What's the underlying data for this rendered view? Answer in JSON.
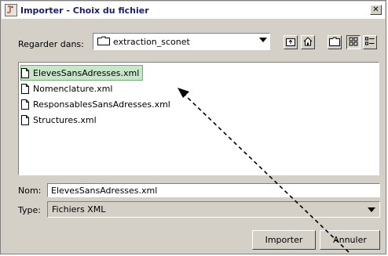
{
  "window": {
    "title": "Importer - Choix du fichier",
    "close_label": "✕"
  },
  "lookin": {
    "label": "Regarder dans:",
    "value": "extraction_sconet"
  },
  "toolbar": {
    "buttons": [
      {
        "name": "up-folder-icon"
      },
      {
        "name": "home-icon"
      },
      {
        "name": "new-folder-icon"
      },
      {
        "name": "list-view-icon"
      },
      {
        "name": "details-view-icon"
      }
    ]
  },
  "files": [
    {
      "name": "ElevesSansAdresses.xml",
      "selected": true
    },
    {
      "name": "Nomenclature.xml",
      "selected": false
    },
    {
      "name": "ResponsablesSansAdresses.xml",
      "selected": false
    },
    {
      "name": "Structures.xml",
      "selected": false
    }
  ],
  "filename": {
    "label": "Nom:",
    "value": "ElevesSansAdresses.xml"
  },
  "filetype": {
    "label": "Type:",
    "value": "Fichiers XML"
  },
  "actions": {
    "import_label": "Importer",
    "cancel_label": "Annuler"
  },
  "colors": {
    "selection": "#c8e6c9",
    "dialog_bg": "#d4d0c8",
    "title_text": "#1c1c6c"
  }
}
